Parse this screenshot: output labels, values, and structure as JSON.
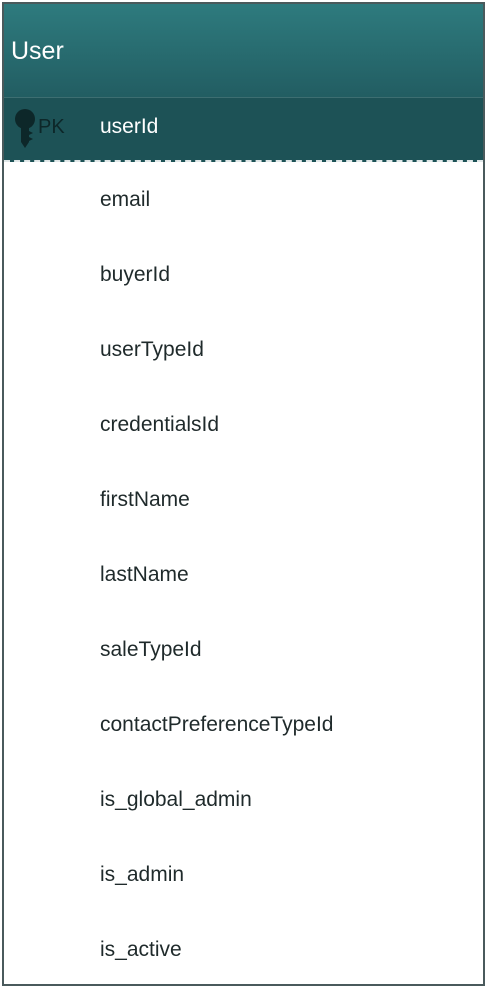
{
  "entity": {
    "title": "User",
    "primary_key": {
      "label": "PK",
      "name": "userId"
    },
    "fields": [
      "email",
      "buyerId",
      "userTypeId",
      "credentialsId",
      "firstName",
      "lastName",
      "saleTypeId",
      "contactPreferenceTypeId",
      "is_global_admin",
      "is_admin",
      "is_active"
    ]
  },
  "icons": {
    "pk": "key-icon"
  },
  "colors": {
    "header_top": "#2e7b7e",
    "header_bottom": "#225d62",
    "pk_row": "#1d5256",
    "border": "#4a5a5c",
    "field_text": "#1f2a2b"
  }
}
